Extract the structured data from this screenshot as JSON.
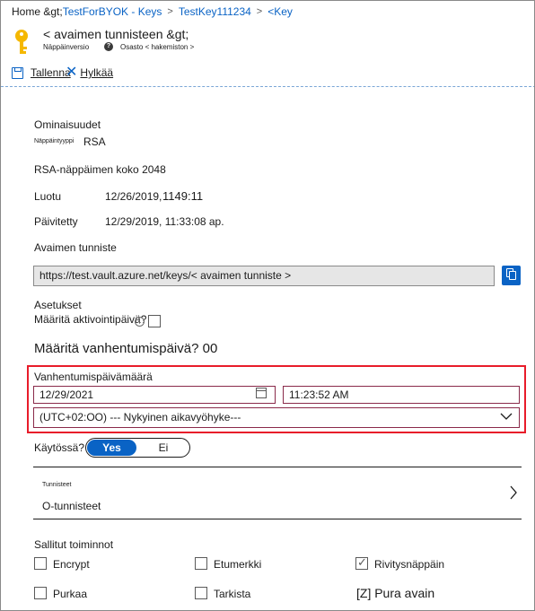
{
  "breadcrumb": {
    "home": "Home &gt;",
    "items": [
      "TestForBYOK - Keys",
      "TestKey111234",
      "<Key"
    ],
    "separators": [
      ">",
      ">"
    ]
  },
  "header": {
    "title": "< avaimen tunnisteen &gt;",
    "subtitle": "Näppäinversio",
    "subtitle2": "Osasto < hakemiston >"
  },
  "toolbar": {
    "save_label": "Tallenna",
    "discard_label": "Hylkää"
  },
  "properties": {
    "heading": "Ominaisuudet",
    "key_type_label": "Näppäintyyppi",
    "key_type_value": "RSA",
    "key_size": "RSA-näppäimen koko 2048",
    "created_label": "Luotu",
    "created_date": "12/26/2019,",
    "created_time": "1149:11",
    "updated_label": "Päivitetty",
    "updated_value": "12/29/2019, 11:33:08 ap.",
    "key_id_label": "Avaimen tunniste",
    "key_id_value": "https://test.vault.azure.net/keys/< avaimen tunniste >"
  },
  "settings": {
    "heading": "Asetukset",
    "activation_label": "Määritä aktivointipäivä?",
    "activation_checked": false,
    "expiry_question": "Määritä vanhentumispäivä? 00",
    "expiry_label": "Vanhentumispäivämäärä",
    "expiry_date": "12/29/2021",
    "expiry_time": "11:23:52 AM",
    "timezone": "(UTC+02:OO) --- Nykyinen aikavyöhyke---",
    "enabled_label": "Käytössä?",
    "enabled_yes": "Yes",
    "enabled_no": "Ei",
    "enabled_value": "Yes"
  },
  "tags": {
    "label": "Tunnisteet",
    "value": "O-tunnisteet"
  },
  "operations": {
    "heading": "Sallitut toiminnot",
    "items": [
      {
        "label": "Encrypt",
        "checked": false
      },
      {
        "label": "Etumerkki",
        "checked": false
      },
      {
        "label": "Rivitysnäppäin",
        "checked": true
      },
      {
        "label": "Purkaa",
        "checked": false
      },
      {
        "label": "Tarkista",
        "checked": false
      },
      {
        "label": "[Z] Pura avain",
        "checked": false
      }
    ]
  },
  "colors": {
    "accent": "#0a63c5",
    "highlight": "#e81c2a",
    "key_icon": "#f5b800"
  },
  "icons": [
    "key-icon",
    "help-icon",
    "save-icon",
    "close-icon",
    "copy-icon",
    "info-icon",
    "calendar-icon",
    "chevron-down-icon",
    "chevron-right-icon",
    "checkmark-icon"
  ]
}
